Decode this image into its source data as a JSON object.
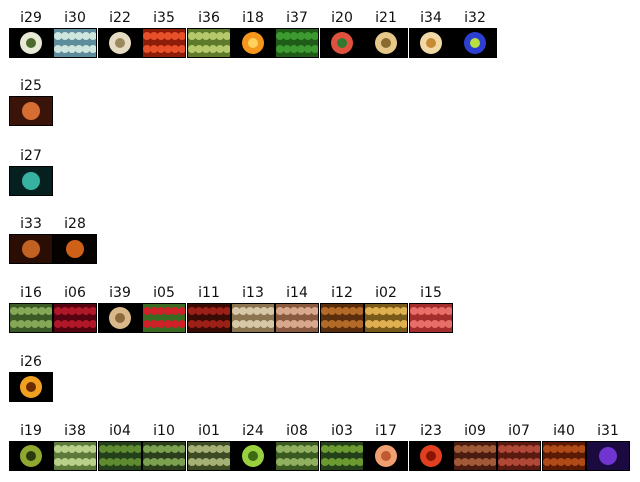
{
  "groups": [
    {
      "items": [
        {
          "label": "i29",
          "icon": "white-onion-icon",
          "colors": [
            "#e8ead6",
            "#4e6b2e"
          ]
        },
        {
          "label": "i30",
          "icon": "white-bowl-icon",
          "colors": [
            "#cfe6df",
            "#5d8c9a"
          ]
        },
        {
          "label": "i22",
          "icon": "pear-slice-icon",
          "colors": [
            "#e6dcc3",
            "#9b8a60"
          ]
        },
        {
          "label": "i35",
          "icon": "red-fruit-icon",
          "colors": [
            "#e8502a",
            "#8d1d08"
          ]
        },
        {
          "label": "i36",
          "icon": "green-mango-icon",
          "colors": [
            "#b5c96c",
            "#5e7a2a"
          ]
        },
        {
          "label": "i18",
          "icon": "orange-slice-icon",
          "colors": [
            "#f6961c",
            "#ffd25b"
          ]
        },
        {
          "label": "i37",
          "icon": "green-peppers-icon",
          "colors": [
            "#3c9a30",
            "#1f5c17"
          ]
        },
        {
          "label": "i20",
          "icon": "watermelon-slice-icon",
          "colors": [
            "#e0523e",
            "#2f7a30"
          ]
        },
        {
          "label": "i21",
          "icon": "melon-halves-icon",
          "colors": [
            "#e6c98a",
            "#8a6a2e"
          ]
        },
        {
          "label": "i34",
          "icon": "papaya-slice-icon",
          "colors": [
            "#f1d9a6",
            "#c78b36"
          ]
        },
        {
          "label": "i32",
          "icon": "blue-flower-icon",
          "colors": [
            "#2b3fd0",
            "#b8e040"
          ]
        }
      ]
    },
    {
      "items": [
        {
          "label": "i25",
          "icon": "sunset-palm-icon",
          "colors": [
            "#e87838",
            "#3a1408"
          ]
        }
      ]
    },
    {
      "items": [
        {
          "label": "i27",
          "icon": "teal-swirl-icon",
          "colors": [
            "#3cc1b0",
            "#05201e"
          ]
        }
      ]
    },
    {
      "items": [
        {
          "label": "i33",
          "icon": "candle-cake-icon",
          "colors": [
            "#d16a26",
            "#2a0e04"
          ]
        },
        {
          "label": "i28",
          "icon": "black-cat-silhouette-icon",
          "colors": [
            "#e66a1a",
            "#060200"
          ]
        }
      ]
    },
    {
      "items": [
        {
          "label": "i16",
          "icon": "brussels-sprouts-icon",
          "colors": [
            "#84a858",
            "#3b5a26"
          ]
        },
        {
          "label": "i06",
          "icon": "red-cherries-icon",
          "colors": [
            "#b0182a",
            "#550310"
          ]
        },
        {
          "label": "i39",
          "icon": "cantaloupe-icon",
          "colors": [
            "#d9b98a",
            "#8e6a3e"
          ]
        },
        {
          "label": "i05",
          "icon": "radishes-icon",
          "colors": [
            "#d02028",
            "#3a6a22"
          ]
        },
        {
          "label": "i11",
          "icon": "red-berries-icon",
          "colors": [
            "#9a2018",
            "#3a0a04"
          ]
        },
        {
          "label": "i13",
          "icon": "ginger-roots-icon",
          "colors": [
            "#d6c7a6",
            "#8a7550"
          ]
        },
        {
          "label": "i14",
          "icon": "potatoes-icon",
          "colors": [
            "#d8a88c",
            "#8a5a40"
          ]
        },
        {
          "label": "i12",
          "icon": "brown-nuts-icon",
          "colors": [
            "#b36a28",
            "#5a2e0c"
          ]
        },
        {
          "label": "i02",
          "icon": "corn-cobs-icon",
          "colors": [
            "#e0b050",
            "#7a5a1a"
          ]
        },
        {
          "label": "i15",
          "icon": "pink-fruits-icon",
          "colors": [
            "#e86e6a",
            "#a32e2c"
          ]
        }
      ]
    },
    {
      "items": [
        {
          "label": "i26",
          "icon": "orange-sunset-icon",
          "colors": [
            "#f2a020",
            "#6a2a04"
          ]
        }
      ]
    },
    {
      "items": [
        {
          "label": "i19",
          "icon": "kiwi-slice-icon",
          "colors": [
            "#8fa830",
            "#2a3a10"
          ]
        },
        {
          "label": "i38",
          "icon": "cabbage-icon",
          "colors": [
            "#b8d08a",
            "#5e7a3a"
          ]
        },
        {
          "label": "i04",
          "icon": "leafy-greens-icon",
          "colors": [
            "#5e8a30",
            "#23401a"
          ]
        },
        {
          "label": "i10",
          "icon": "herb-sprigs-icon",
          "colors": [
            "#7aa050",
            "#2b3e1c"
          ]
        },
        {
          "label": "i01",
          "icon": "sprouts-icon",
          "colors": [
            "#a4b074",
            "#3e4a24"
          ]
        },
        {
          "label": "i24",
          "icon": "pepper-slice-icon",
          "colors": [
            "#9ad040",
            "#3a6a12"
          ]
        },
        {
          "label": "i08",
          "icon": "asparagus-icon",
          "colors": [
            "#90b060",
            "#3b5a22"
          ]
        },
        {
          "label": "i03",
          "icon": "green-beans-icon",
          "colors": [
            "#6a9a30",
            "#24401a"
          ]
        },
        {
          "label": "i17",
          "icon": "onion-slice-icon",
          "colors": [
            "#f0a070",
            "#c05a30"
          ]
        },
        {
          "label": "i23",
          "icon": "tomato-slice-icon",
          "colors": [
            "#e04020",
            "#8a1404"
          ]
        },
        {
          "label": "i09",
          "icon": "chestnuts-icon",
          "colors": [
            "#a05a38",
            "#4a1c10"
          ]
        },
        {
          "label": "i07",
          "icon": "red-beans-icon",
          "colors": [
            "#b04838",
            "#5a1a10"
          ]
        },
        {
          "label": "i40",
          "icon": "dates-icon",
          "colors": [
            "#b04a18",
            "#5a1a04"
          ]
        },
        {
          "label": "i31",
          "icon": "purple-spiral-icon",
          "colors": [
            "#7a3ae0",
            "#1a0a40"
          ]
        }
      ]
    }
  ]
}
